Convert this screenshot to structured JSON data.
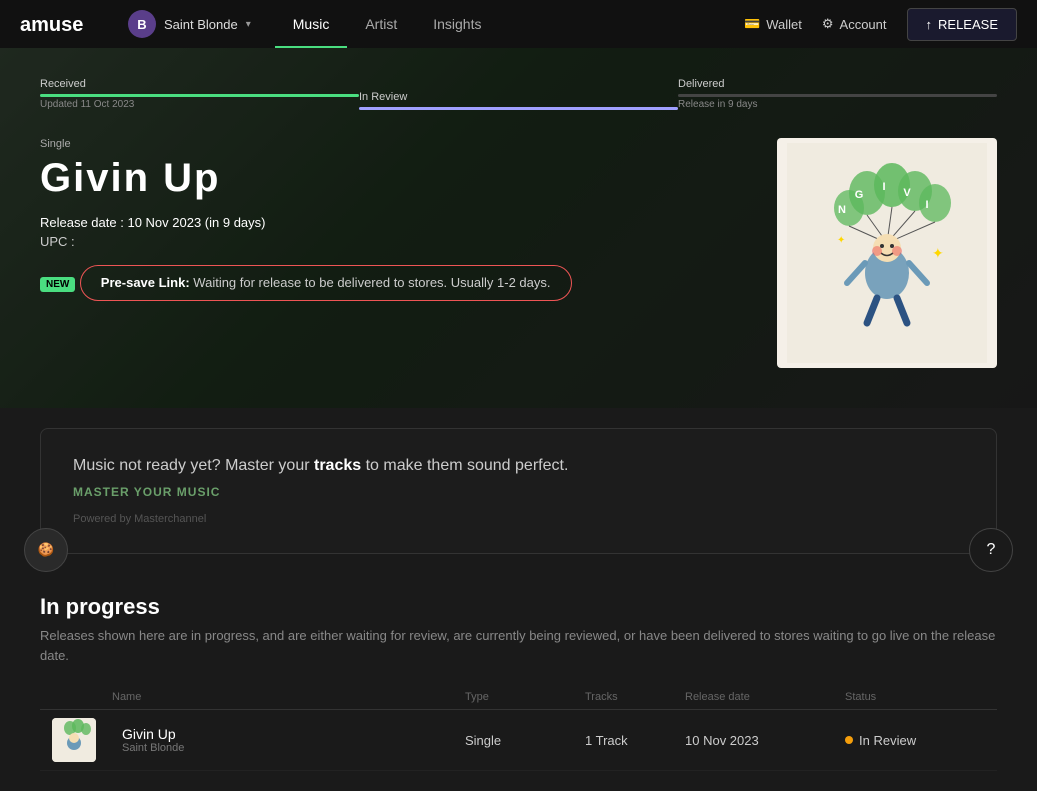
{
  "header": {
    "logo_text": "amuse",
    "user": {
      "initial": "B",
      "name": "Saint Blonde"
    },
    "nav": [
      {
        "label": "Music",
        "active": true
      },
      {
        "label": "Artist",
        "active": false
      },
      {
        "label": "Insights",
        "active": false
      }
    ],
    "nav_right": [
      {
        "label": "Wallet",
        "icon": "wallet-icon"
      },
      {
        "label": "Account",
        "icon": "gear-icon"
      }
    ],
    "release_button": "RELEASE"
  },
  "progress": {
    "steps": [
      {
        "label": "Received",
        "sub": "Updated 11 Oct 2023",
        "state": "done"
      },
      {
        "label": "In Review",
        "sub": "",
        "state": "active"
      },
      {
        "label": "Delivered",
        "sub": "Release in 9 days",
        "state": "inactive"
      }
    ]
  },
  "release": {
    "type": "Single",
    "title": "Givin Up",
    "release_date_label": "Release date :",
    "release_date_value": "10 Nov 2023  (in 9 days)",
    "upc_label": "UPC :",
    "upc_value": "",
    "badge": "NEW",
    "pre_save_label": "Pre-save Link:",
    "pre_save_desc": "Waiting for release to be delivered to stores. Usually 1-2 days."
  },
  "master": {
    "title_prefix": "Music not ready yet? Master your",
    "title_highlight": "tracks",
    "title_suffix": "to make them sound perfect.",
    "link_label": "MASTER YOUR MUSIC",
    "powered_by": "Powered by Masterchannel"
  },
  "in_progress": {
    "title": "In progress",
    "description": "Releases shown here are in progress, and are either waiting for review, are currently being reviewed, or have been delivered to stores waiting to go live on the release date.",
    "table": {
      "headers": [
        "",
        "Name",
        "Type",
        "Tracks",
        "Release date",
        "Status"
      ],
      "rows": [
        {
          "name": "Givin Up",
          "artist": "Saint Blonde",
          "type": "Single",
          "tracks": "1 Track",
          "release_date": "10 Nov 2023",
          "status": "In Review",
          "status_color": "#f59e0b"
        }
      ]
    }
  },
  "fab": {
    "icon": "chat-icon",
    "label": "?"
  },
  "cookie": {
    "icon": "cookie-icon"
  }
}
